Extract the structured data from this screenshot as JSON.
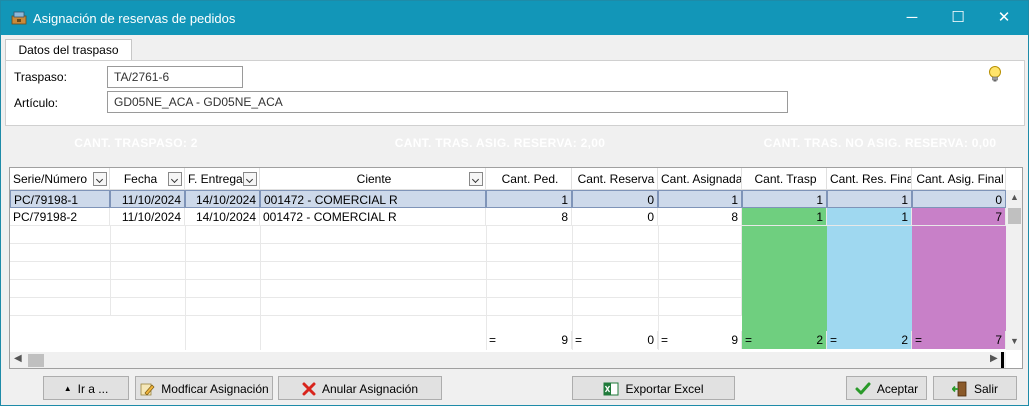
{
  "window": {
    "title": "Asignación de reservas de pedidos",
    "min_glyph": "─",
    "max_glyph": "☐",
    "close_glyph": "✕",
    "app_icon": "reservation-app-icon"
  },
  "tab": {
    "label": "Datos del traspaso"
  },
  "form": {
    "traspaso_label": "Traspaso:",
    "traspaso_value": "TA/2761-6",
    "articulo_label": "Artículo:",
    "articulo_value": "GD05NE_ACA - GD05NE_ACA",
    "hint_icon": "lightbulb-icon"
  },
  "banners": {
    "traspaso": "CANT. TRASPASO: 2",
    "asig": "CANT. TRAS. ASIG. RESERVA: 2,00",
    "no_asig": "CANT. TRAS. NO ASIG. RESERVA: 0,00"
  },
  "colors": {
    "banner_traspaso": "#ff7f3f",
    "banner_asig": "#008080",
    "banner_no_asig": "#f08080",
    "col_traspaso": "#6fcf7f",
    "col_res_final": "#9fd8f0",
    "col_asig_final": "#c880c8"
  },
  "table": {
    "headers": [
      "Serie/Número",
      "Fecha",
      "F. Entrega",
      "Ciente",
      "Cant. Ped.",
      "Cant. Reserva",
      "Cant. Asignada",
      "Cant. Trasp",
      "Cant. Res. Final",
      "Cant. Asig. Final"
    ],
    "rows": [
      [
        "PC/79198-1",
        "11/10/2024",
        "14/10/2024",
        "001472 - COMERCIAL R",
        "1",
        "0",
        "1",
        "1",
        "1",
        "0"
      ],
      [
        "PC/79198-2",
        "11/10/2024",
        "14/10/2024",
        "001472 - COMERCIAL R",
        "8",
        "0",
        "8",
        "1",
        "1",
        "7"
      ]
    ],
    "totals": {
      "eq": "=",
      "cant_ped": "9",
      "cant_reserva": "0",
      "cant_asignada": "9",
      "cant_trasp": "2",
      "cant_res_final": "2",
      "cant_asig_final": "7"
    }
  },
  "buttons": {
    "ir": "Ir a ...",
    "modificar": "Modficar Asignación",
    "anular": "Anular Asignación",
    "exportar": "Exportar Excel",
    "aceptar": "Aceptar",
    "salir": "Salir"
  }
}
